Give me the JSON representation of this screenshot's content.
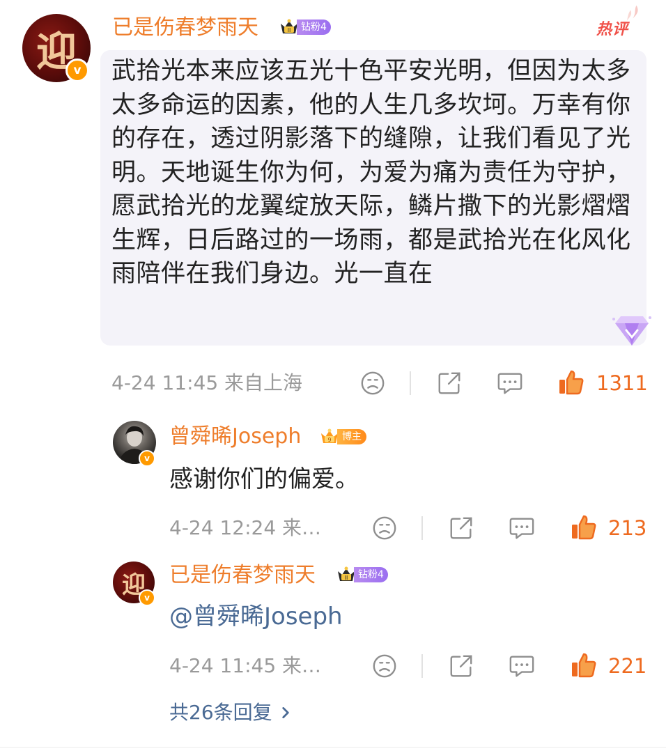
{
  "comment": {
    "username": "已是伤春梦雨天",
    "fan_level": "钻粉4",
    "avatar_glyph": "迎",
    "hot_tag": "热评",
    "text": "武拾光本来应该五光十色平安光明，但因为太多太多命运的因素，他的人生几多坎坷。万幸有你的存在，透过阴影落下的缝隙，让我们看见了光明。天地诞生你为何，为爱为痛为责任为守护，愿武拾光的龙翼绽放天际，鳞片撒下的光影熠熠生辉，日后路过的一场雨，都是武拾光在化风化雨陪伴在我们身边。光一直在",
    "meta": "4-24 11:45 来自上海",
    "likes": "1311"
  },
  "replies": [
    {
      "username": "曾舜晞Joseph",
      "badge": "博主",
      "text": "感谢你们的偏爱。",
      "meta": "4-24 12:24 来…",
      "likes": "213"
    },
    {
      "username": "已是伤春梦雨天",
      "badge": "钻粉4",
      "avatar_glyph": "迎",
      "text": "@曾舜晞Joseph",
      "meta": "4-24 11:45 来…",
      "likes": "221"
    }
  ],
  "more_replies": "共26条回复",
  "colors": {
    "username": "#ee7d2b",
    "like": "#ee6a1f",
    "link": "#4a6a94",
    "hot": "#f0524a",
    "fan_badge": "#9a6ef0",
    "host_badge": "#ff8a1a",
    "vip_badge": "#ff9a00"
  },
  "icons": [
    "crown-icon",
    "diamond-icon",
    "dislike-icon",
    "share-icon",
    "comment-icon",
    "like-icon",
    "chevron-right-icon"
  ]
}
